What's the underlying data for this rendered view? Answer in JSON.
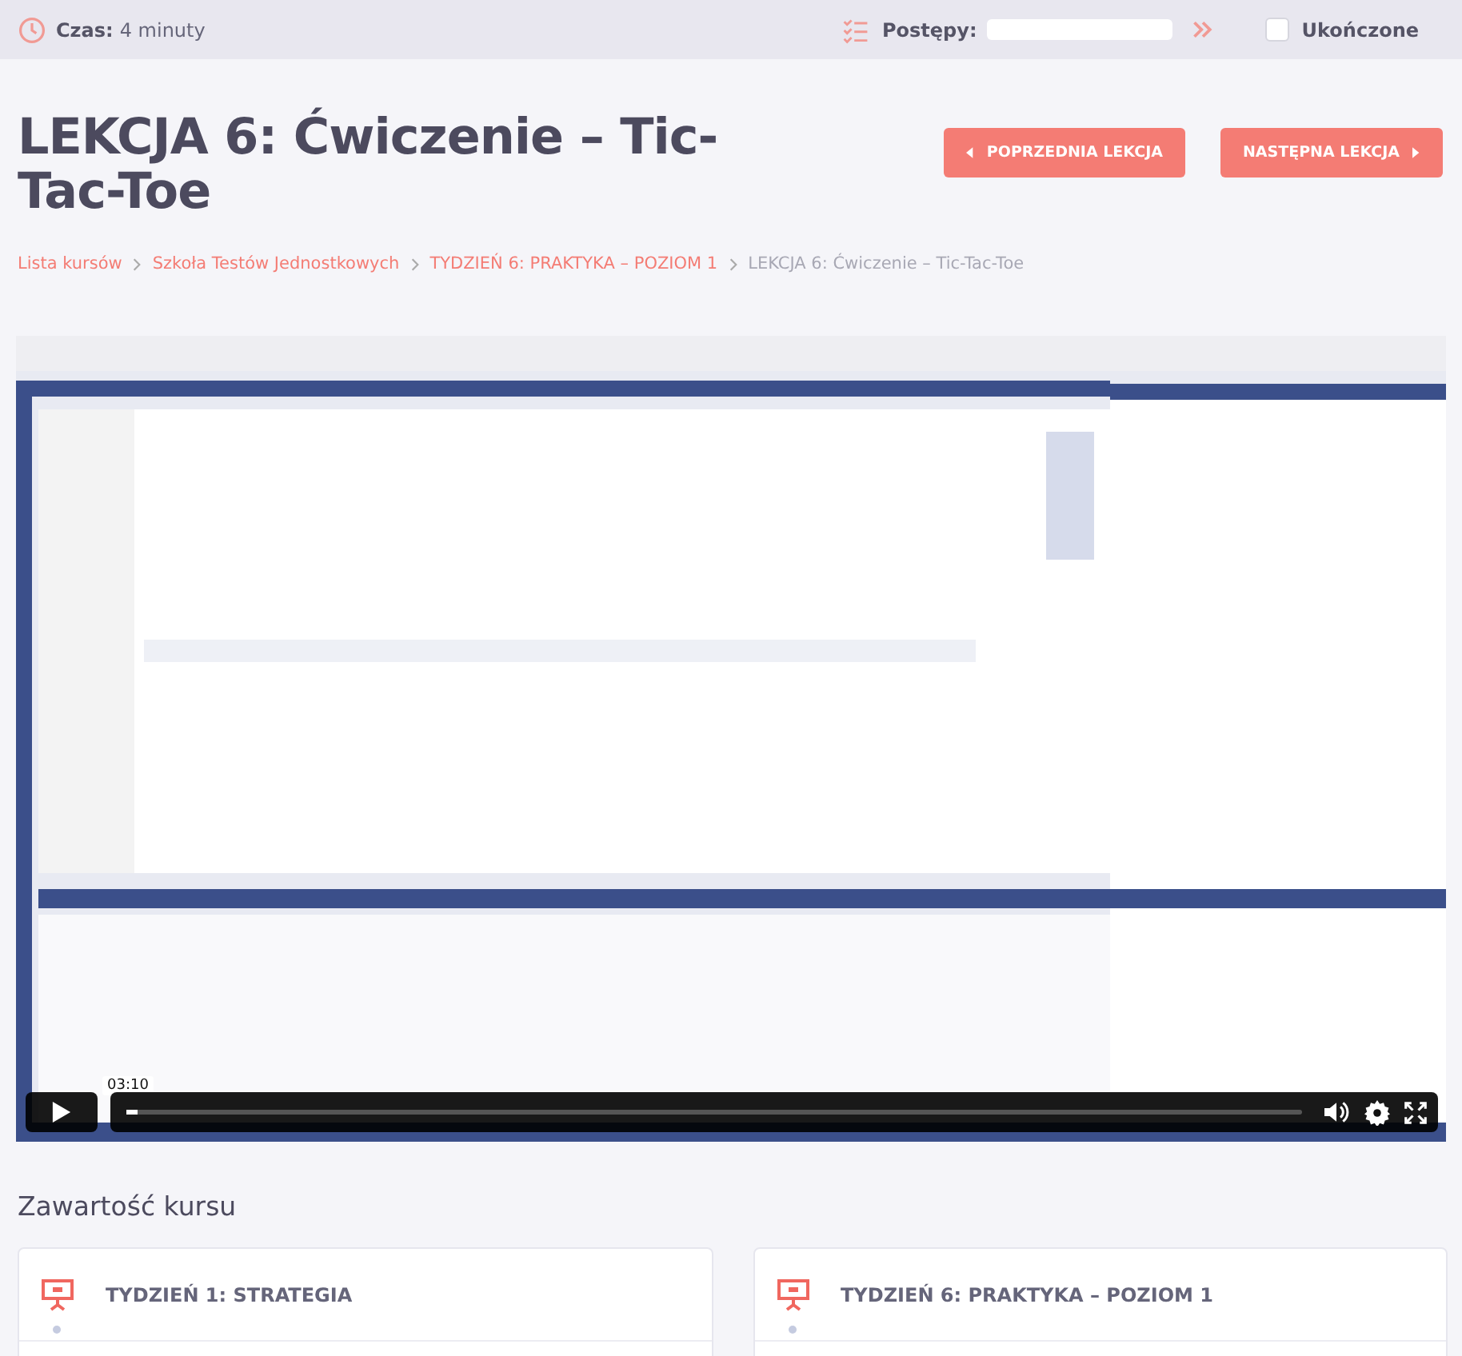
{
  "top_bar": {
    "time_label": "Czas:",
    "time_value": "4 minuty",
    "progress_label": "Postępy:",
    "progress": {
      "level": 0
    },
    "completed": {
      "label": "Ukończone",
      "checked": false
    }
  },
  "title": "LEKCJA 6: Ćwiczenie – Tic-Tac-Toe",
  "nav_buttons": [
    {
      "label": "POPRZEDNIA LEKCJA",
      "kind": "prev"
    },
    {
      "label": "NASTĘPNA LEKCJA",
      "kind": "next"
    }
  ],
  "breadcrumbs": [
    {
      "label": "Lista kursów",
      "current": false
    },
    {
      "label": "Szkoła Testów Jednostkowych",
      "current": false
    },
    {
      "label": "TYDZIEŃ 6: PRAKTYKA – POZIOM 1",
      "current": false
    },
    {
      "label": "LEKCJA 6: Ćwiczenie – Tic-Tac-Toe",
      "current": true
    }
  ],
  "video": {
    "kind": "picture",
    "time_tooltip": "03:10",
    "playback": {
      "level": 0.01
    }
  },
  "course_content": {
    "heading": "Zawartość kursu",
    "sections": [
      {
        "title": "TYDZIEŃ 1: STRATEGIA"
      },
      {
        "title": "TYDZIEŃ 6: PRAKTYKA – POZIOM 1"
      }
    ]
  }
}
